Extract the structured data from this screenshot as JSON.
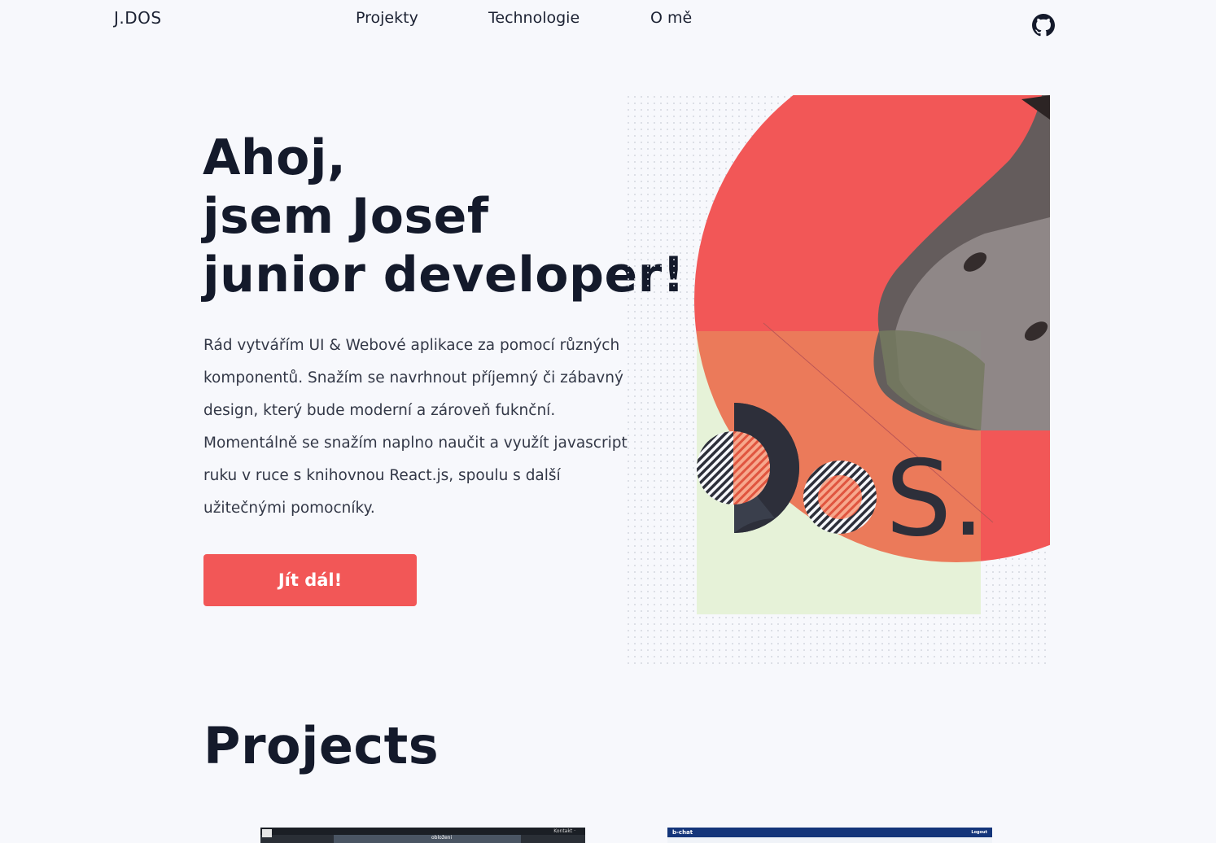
{
  "header": {
    "logo": "J.DOS",
    "nav": [
      "Projekty",
      "Technologie",
      "O mě"
    ],
    "github_icon": "github-icon"
  },
  "hero": {
    "title_lines": [
      "Ahoj,",
      "jsem Josef",
      "junior developer!"
    ],
    "description": "Rád vytvářím UI & Webové aplikace za pomocí různých komponentů. Snažím se navrhnout příjemný či zábavný design, který bude moderní a zároveň fuknční. Momentálně se snažím naplno naučit a využít javascript ruku v ruce s knihovnou React.js, spoulu s další užitečnými pomocníky.",
    "cta_label": "Jít dál!",
    "logo_text": "S.",
    "colors": {
      "accent": "#f25757",
      "dark": "#141a2b",
      "mint": "#e6f2d8"
    }
  },
  "projects": {
    "title": "Projects",
    "thumbs": [
      {
        "bar_text": "Kontakt ·",
        "strip_text": "obloženi"
      },
      {
        "bar_left": "b-chat",
        "bar_right": "Logout"
      }
    ]
  }
}
